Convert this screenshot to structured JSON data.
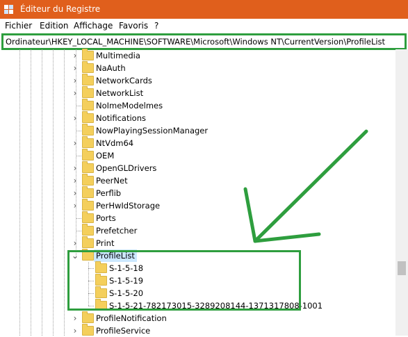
{
  "window": {
    "title": "Éditeur du Registre"
  },
  "menu": [
    "Fichier",
    "Edition",
    "Affichage",
    "Favoris",
    "?"
  ],
  "address": {
    "path": "Ordinateur\\HKEY_LOCAL_MACHINE\\SOFTWARE\\Microsoft\\Windows NT\\CurrentVersion\\ProfileList"
  },
  "tree": {
    "items": [
      {
        "label": "Multimedia",
        "chevron": "›"
      },
      {
        "label": "NaAuth",
        "chevron": "›"
      },
      {
        "label": "NetworkCards",
        "chevron": "›"
      },
      {
        "label": "NetworkList",
        "chevron": "›"
      },
      {
        "label": "NoImeModelmes",
        "chevron": ""
      },
      {
        "label": "Notifications",
        "chevron": "›"
      },
      {
        "label": "NowPlayingSessionManager",
        "chevron": ""
      },
      {
        "label": "NtVdm64",
        "chevron": "›"
      },
      {
        "label": "OEM",
        "chevron": ""
      },
      {
        "label": "OpenGLDrivers",
        "chevron": "›"
      },
      {
        "label": "PeerNet",
        "chevron": "›"
      },
      {
        "label": "Perflib",
        "chevron": "›"
      },
      {
        "label": "PerHwIdStorage",
        "chevron": "›"
      },
      {
        "label": "Ports",
        "chevron": ""
      },
      {
        "label": "Prefetcher",
        "chevron": ""
      },
      {
        "label": "Print",
        "chevron": "›"
      },
      {
        "label": "ProfileList",
        "chevron": "⌄"
      },
      {
        "label": "S-1-5-18",
        "chevron": ""
      },
      {
        "label": "S-1-5-19",
        "chevron": ""
      },
      {
        "label": "S-1-5-20",
        "chevron": ""
      },
      {
        "label": "S-1-5-21-782173015-3289208144-1371317808-1001",
        "chevron": ""
      },
      {
        "label": "ProfileNotification",
        "chevron": "›"
      },
      {
        "label": "ProfileService",
        "chevron": "›"
      }
    ]
  },
  "colors": {
    "titlebar": "#e05f1c",
    "highlight": "#2e9e3e",
    "folder": "#f4cf5c"
  }
}
